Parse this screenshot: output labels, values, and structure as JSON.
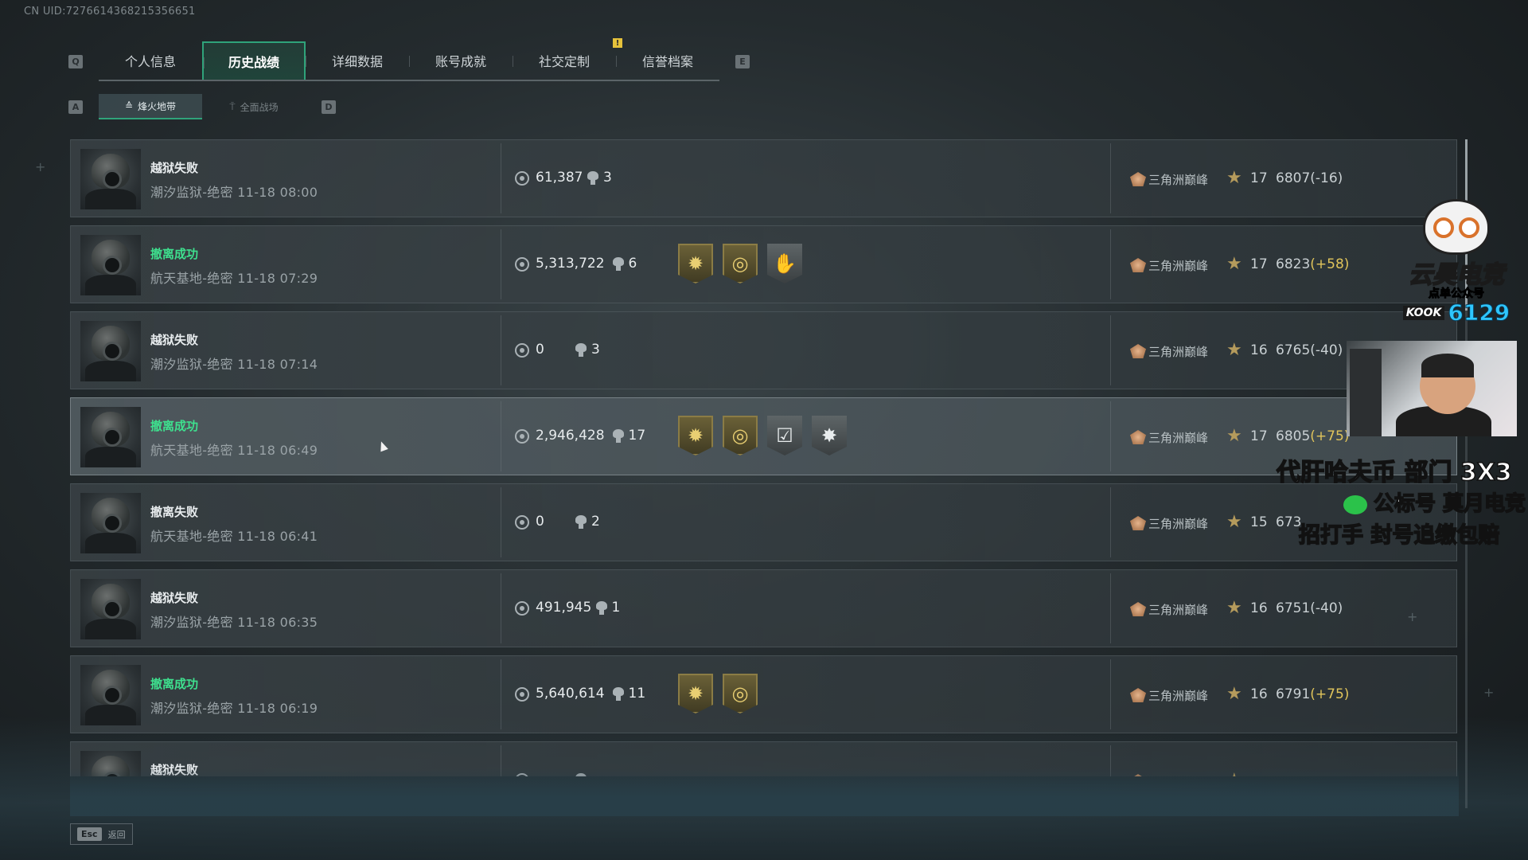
{
  "header": {
    "uid": "CN UID:7276614368215356651"
  },
  "tabs": {
    "left_key": "Q",
    "right_key": "E",
    "items": [
      {
        "label": "个人信息",
        "active": false
      },
      {
        "label": "历史战绩",
        "active": true
      },
      {
        "label": "详细数据",
        "active": false
      },
      {
        "label": "账号成就",
        "active": false
      },
      {
        "label": "社交定制",
        "active": false,
        "notice": "!"
      },
      {
        "label": "信誉档案",
        "active": false
      }
    ]
  },
  "subtabs": {
    "left_key": "A",
    "right_key": "D",
    "items": [
      {
        "label": "烽火地带",
        "icon": "flame-zone-icon",
        "active": true
      },
      {
        "label": "全面战场",
        "icon": "battlefield-icon",
        "active": false
      }
    ]
  },
  "matches": [
    {
      "result": "越狱失败",
      "success": false,
      "map": "潮汐监狱-绝密 11-18 08:00",
      "money": "61,387",
      "kills": "3",
      "badges": [],
      "rank": "三角洲巅峰",
      "level": "17",
      "score": "6807",
      "delta": "(-16)",
      "delta_up": false
    },
    {
      "result": "撤离成功",
      "success": true,
      "map": "航天基地-绝密 11-18 07:29",
      "money": "5,313,722",
      "kills": "6",
      "badges": [
        {
          "type": "gold",
          "icon": "sun-emblem-icon",
          "glyph": "✹"
        },
        {
          "type": "gold",
          "icon": "coin-emblem-icon",
          "glyph": "◎"
        },
        {
          "type": "silver",
          "icon": "hand-emblem-icon",
          "glyph": "✋"
        }
      ],
      "rank": "三角洲巅峰",
      "level": "17",
      "score": "6823",
      "delta": "(+58)",
      "delta_up": true
    },
    {
      "result": "越狱失败",
      "success": false,
      "map": "潮汐监狱-绝密 11-18 07:14",
      "money": "0",
      "kills": "3",
      "badges": [],
      "rank": "三角洲巅峰",
      "level": "16",
      "score": "6765",
      "delta": "(-40)",
      "delta_up": false
    },
    {
      "result": "撤离成功",
      "success": true,
      "map": "航天基地-绝密 11-18 06:49",
      "money": "2,946,428",
      "kills": "17",
      "badges": [
        {
          "type": "gold",
          "icon": "sun-emblem-icon",
          "glyph": "✹"
        },
        {
          "type": "gold",
          "icon": "coin-emblem-icon",
          "glyph": "◎"
        },
        {
          "type": "silver",
          "icon": "checklist-emblem-icon",
          "glyph": "☑"
        },
        {
          "type": "silver",
          "icon": "star-burst-emblem-icon",
          "glyph": "✸"
        }
      ],
      "rank": "三角洲巅峰",
      "level": "17",
      "score": "6805",
      "delta": "(+75)",
      "delta_up": true,
      "hover": true
    },
    {
      "result": "撤离失败",
      "success": false,
      "map": "航天基地-绝密 11-18 06:41",
      "money": "0",
      "kills": "2",
      "badges": [],
      "rank": "三角洲巅峰",
      "level": "15",
      "score": "673",
      "delta": "",
      "delta_up": false
    },
    {
      "result": "越狱失败",
      "success": false,
      "map": "潮汐监狱-绝密 11-18 06:35",
      "money": "491,945",
      "kills": "1",
      "badges": [],
      "rank": "三角洲巅峰",
      "level": "16",
      "score": "6751",
      "delta": "(-40)",
      "delta_up": false
    },
    {
      "result": "撤离成功",
      "success": true,
      "map": "潮汐监狱-绝密 11-18 06:19",
      "money": "5,640,614",
      "kills": "11",
      "badges": [
        {
          "type": "gold",
          "icon": "sun-emblem-icon",
          "glyph": "✹"
        },
        {
          "type": "gold",
          "icon": "coin-emblem-icon",
          "glyph": "◎"
        }
      ],
      "rank": "三角洲巅峰",
      "level": "16",
      "score": "6791",
      "delta": "(+75)",
      "delta_up": true
    },
    {
      "result": "越狱失败",
      "success": false,
      "map": "",
      "money": "",
      "kills": "",
      "badges": [],
      "rank": "",
      "level": "",
      "score": "",
      "delta": "",
      "delta_up": false
    }
  ],
  "footer": {
    "esc_key": "Esc",
    "esc_label": "返回"
  },
  "overlay": {
    "brand": "云昊电竞",
    "brand_sub": "点单公众号",
    "kook_label": "KOOK",
    "kook_number": "6129",
    "line1": "代肝哈夫币 部门 3X3",
    "line2": "公标号 莫月电竞",
    "line3": "招打手 封号追缴包赔"
  },
  "colors": {
    "accent": "#2fa37a",
    "success": "#3ee08e",
    "delta_up": "#e0c45b",
    "gold_badge": "#8b7c45"
  }
}
